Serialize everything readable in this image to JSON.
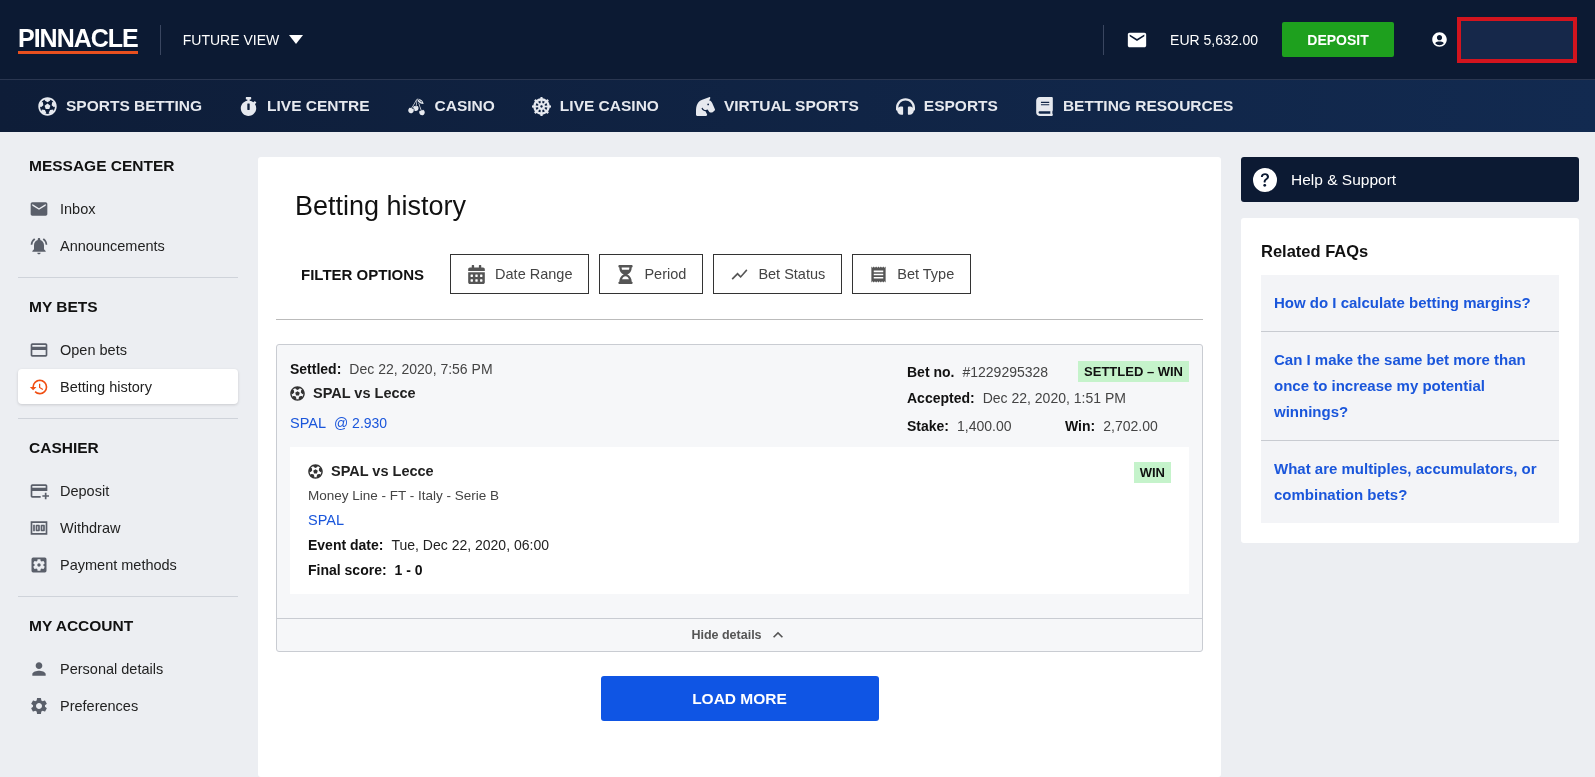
{
  "header": {
    "logo": "PINNACLE",
    "view_menu": "FUTURE VIEW",
    "balance": "EUR 5,632.00",
    "deposit_button": "DEPOSIT"
  },
  "nav": [
    {
      "kind": "ball",
      "label": "SPORTS BETTING"
    },
    {
      "kind": "stopwatch",
      "label": "LIVE CENTRE"
    },
    {
      "kind": "cherry",
      "label": "CASINO"
    },
    {
      "kind": "wheel",
      "label": "LIVE CASINO"
    },
    {
      "kind": "horse",
      "label": "VIRTUAL SPORTS"
    },
    {
      "kind": "headset",
      "label": "ESPORTS"
    },
    {
      "kind": "book",
      "label": "BETTING RESOURCES"
    }
  ],
  "sidebar": [
    {
      "title": "MESSAGE CENTER",
      "items": [
        {
          "kind": "mail",
          "label": "Inbox",
          "selected": false
        },
        {
          "kind": "bell",
          "label": "Announcements",
          "selected": false
        }
      ]
    },
    {
      "title": "MY BETS",
      "items": [
        {
          "kind": "card",
          "label": "Open bets",
          "selected": false
        },
        {
          "kind": "history",
          "label": "Betting history",
          "selected": true
        }
      ]
    },
    {
      "title": "CASHIER",
      "items": [
        {
          "kind": "deposit",
          "label": "Deposit",
          "selected": false
        },
        {
          "kind": "cash",
          "label": "Withdraw",
          "selected": false
        },
        {
          "kind": "gear-card",
          "label": "Payment methods",
          "selected": false
        }
      ]
    },
    {
      "title": "MY ACCOUNT",
      "items": [
        {
          "kind": "person",
          "label": "Personal details",
          "selected": false
        },
        {
          "kind": "gear",
          "label": "Preferences",
          "selected": false
        }
      ]
    }
  ],
  "main": {
    "title": "Betting history",
    "filter_label": "FILTER OPTIONS",
    "filters": [
      {
        "kind": "calendar",
        "label": "Date Range"
      },
      {
        "kind": "hourglass",
        "label": "Period"
      },
      {
        "kind": "chart",
        "label": "Bet Status"
      },
      {
        "kind": "receipt",
        "label": "Bet Type"
      }
    ],
    "bet": {
      "settled_label": "Settled:",
      "settled": "Dec 22, 2020, 7:56 PM",
      "event": "SPAL vs Lecce",
      "pick": "SPAL",
      "odds": "@ 2.930",
      "bet_no_label": "Bet no.",
      "bet_no": "#1229295328",
      "status": "SETTLED – WIN",
      "accepted_label": "Accepted:",
      "accepted": "Dec 22, 2020, 1:51 PM",
      "stake_label": "Stake:",
      "stake": "1,400.00",
      "win_label": "Win:",
      "win": "2,702.00",
      "leg": {
        "event": "SPAL vs Lecce",
        "result": "WIN",
        "market": "Money Line - FT - Italy - Serie B",
        "pick": "SPAL",
        "event_date_label": "Event date:",
        "event_date": "Tue, Dec 22, 2020, 06:00",
        "score_label": "Final score:",
        "score": "1 - 0"
      },
      "toggle": "Hide details",
      "expanded": true
    },
    "load_more": "LOAD MORE"
  },
  "help": {
    "label": "Help & Support"
  },
  "faqs": {
    "title": "Related FAQs",
    "items": [
      "How do I calculate betting margins?",
      "Can I make the same bet more than once to increase my potential winnings?",
      "What are multiples, accumulators, or combination bets?"
    ]
  }
}
